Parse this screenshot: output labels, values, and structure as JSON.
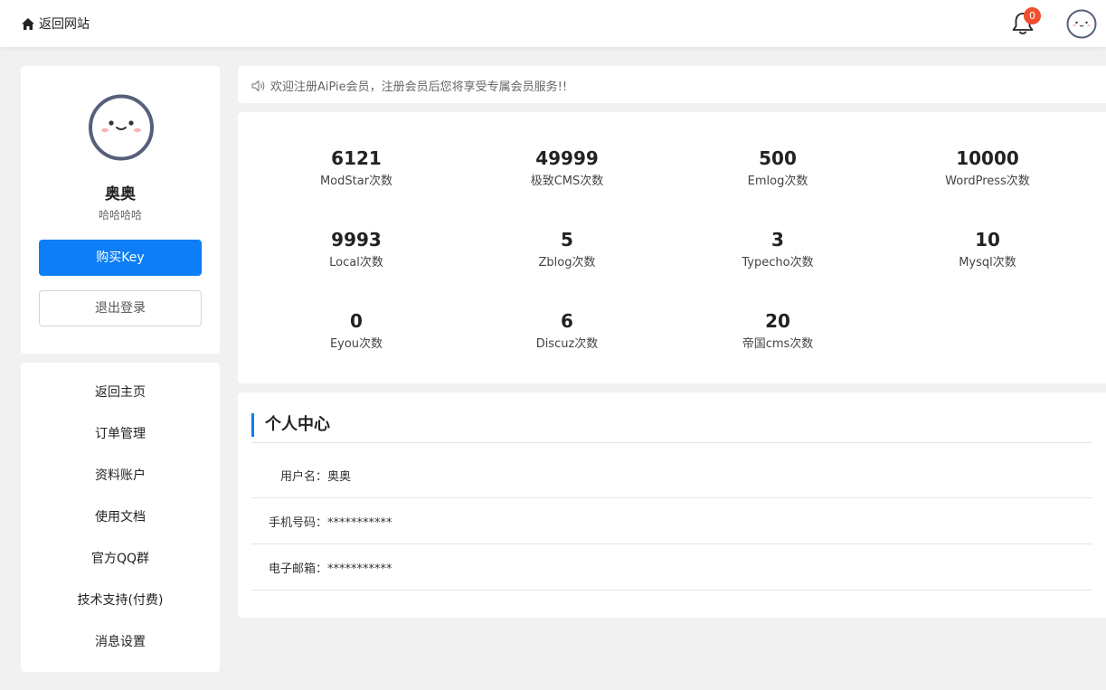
{
  "topbar": {
    "back_label": "返回网站",
    "notification_count": "0"
  },
  "profile": {
    "name": "奥奥",
    "signature": "哈哈哈哈",
    "buy_label": "购买Key",
    "logout_label": "退出登录"
  },
  "menu": {
    "items": [
      "返回主页",
      "订单管理",
      "资料账户",
      "使用文档",
      "官方QQ群",
      "技术支持(付费)",
      "消息设置"
    ]
  },
  "notice": {
    "text": "欢迎注册AiPie会员，注册会员后您将享受专属会员服务!!"
  },
  "stats": [
    {
      "value": "6121",
      "label": "ModStar次数"
    },
    {
      "value": "49999",
      "label": "极致CMS次数"
    },
    {
      "value": "500",
      "label": "Emlog次数"
    },
    {
      "value": "10000",
      "label": "WordPress次数"
    },
    {
      "value": "9993",
      "label": "Local次数"
    },
    {
      "value": "5",
      "label": "Zblog次数"
    },
    {
      "value": "3",
      "label": "Typecho次数"
    },
    {
      "value": "10",
      "label": "Mysql次数"
    },
    {
      "value": "0",
      "label": "Eyou次数"
    },
    {
      "value": "6",
      "label": "Discuz次数"
    },
    {
      "value": "20",
      "label": "帝国cms次数"
    }
  ],
  "center": {
    "title": "个人中心",
    "fields": [
      {
        "label": "用户名：",
        "value": "奥奥"
      },
      {
        "label": "手机号码：",
        "value": "***********"
      },
      {
        "label": "电子邮箱：",
        "value": "***********"
      }
    ]
  },
  "colors": {
    "accent": "#0d7ef5",
    "badge": "#f04e2f",
    "background": "#f1f1f1"
  }
}
